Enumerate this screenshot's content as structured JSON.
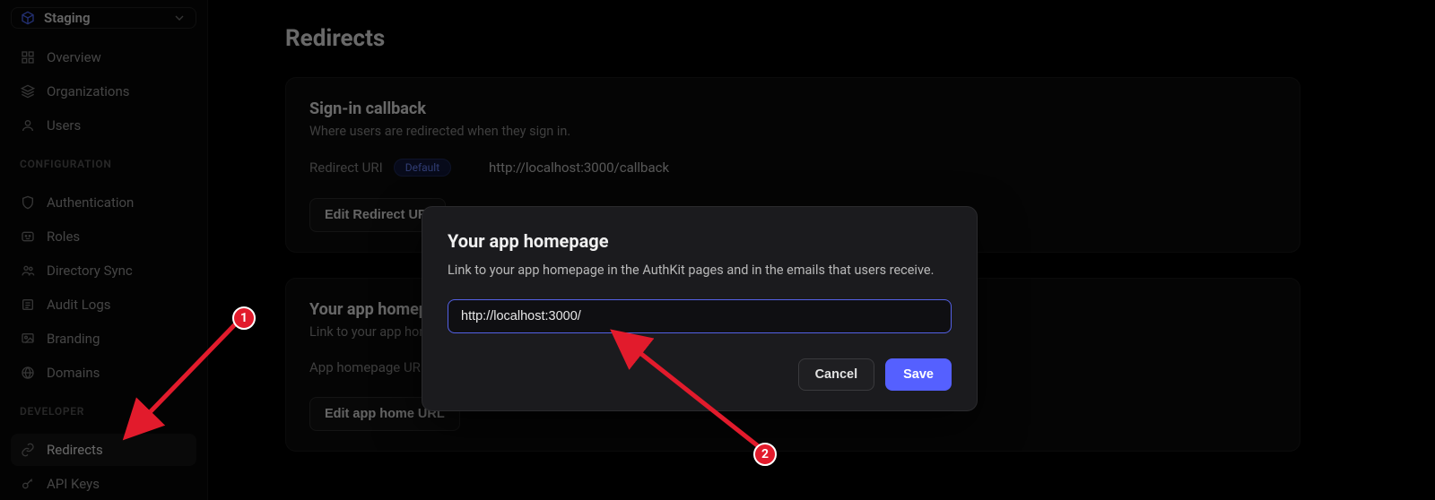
{
  "env": {
    "label": "Staging"
  },
  "sidebar": {
    "primary": [
      {
        "label": "Overview",
        "icon": "grid-icon"
      },
      {
        "label": "Organizations",
        "icon": "stack-icon"
      },
      {
        "label": "Users",
        "icon": "person-icon"
      }
    ],
    "config_heading": "CONFIGURATION",
    "config": [
      {
        "label": "Authentication",
        "icon": "shield-icon"
      },
      {
        "label": "Roles",
        "icon": "faces-icon"
      },
      {
        "label": "Directory Sync",
        "icon": "people-icon"
      },
      {
        "label": "Audit Logs",
        "icon": "list-icon"
      },
      {
        "label": "Branding",
        "icon": "image-icon"
      },
      {
        "label": "Domains",
        "icon": "globe-icon"
      }
    ],
    "dev_heading": "DEVELOPER",
    "dev": [
      {
        "label": "Redirects",
        "icon": "link-icon",
        "active": true
      },
      {
        "label": "API Keys",
        "icon": "key-icon"
      }
    ]
  },
  "page": {
    "title": "Redirects"
  },
  "cards": {
    "signin": {
      "title": "Sign-in callback",
      "desc": "Where users are redirected when they sign in.",
      "row_label": "Redirect URI",
      "badge": "Default",
      "value": "http://localhost:3000/callback",
      "button": "Edit Redirect URI"
    },
    "homepage": {
      "title": "Your app homepage",
      "desc": "Link to your app homepage",
      "row_label": "App homepage URL",
      "button": "Edit app home URL"
    }
  },
  "modal": {
    "title": "Your app homepage",
    "desc": "Link to your app homepage in the AuthKit pages and in the emails that users receive.",
    "input_value": "http://localhost:3000/",
    "cancel": "Cancel",
    "save": "Save"
  },
  "annotations": {
    "one": "1",
    "two": "2"
  }
}
